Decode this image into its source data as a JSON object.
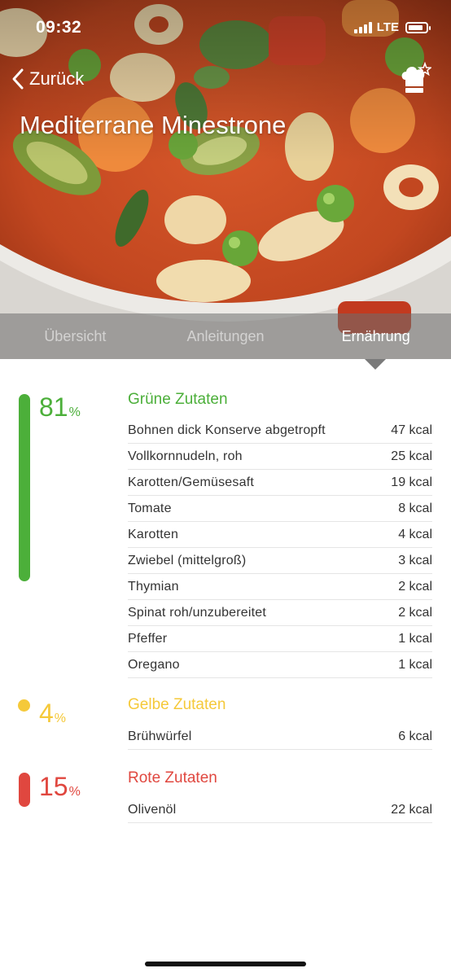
{
  "status_bar": {
    "time": "09:32",
    "network": "LTE"
  },
  "nav": {
    "back_label": "Zurück"
  },
  "recipe": {
    "title": "Mediterrane Minestrone"
  },
  "tabs": [
    {
      "label": "Übersicht",
      "active": false
    },
    {
      "label": "Anleitungen",
      "active": false
    },
    {
      "label": "Ernährung",
      "active": true
    }
  ],
  "groups": [
    {
      "percent": "81",
      "percent_symbol": "%",
      "title": "Grüne Zutaten",
      "color": "#4caf3a",
      "items": [
        {
          "name": "Bohnen dick Konserve abgetropft",
          "kcal": "47 kcal"
        },
        {
          "name": "Vollkornnudeln, roh",
          "kcal": "25 kcal"
        },
        {
          "name": "Karotten/Gemüsesaft",
          "kcal": "19 kcal"
        },
        {
          "name": "Tomate",
          "kcal": "8 kcal"
        },
        {
          "name": "Karotten",
          "kcal": "4 kcal"
        },
        {
          "name": "Zwiebel (mittelgroß)",
          "kcal": "3 kcal"
        },
        {
          "name": "Thymian",
          "kcal": "2 kcal"
        },
        {
          "name": "Spinat roh/unzubereitet",
          "kcal": "2 kcal"
        },
        {
          "name": "Pfeffer",
          "kcal": "1 kcal"
        },
        {
          "name": "Oregano",
          "kcal": "1 kcal"
        }
      ]
    },
    {
      "percent": "4",
      "percent_symbol": "%",
      "title": "Gelbe Zutaten",
      "color": "#f5c93a",
      "items": [
        {
          "name": "Brühwürfel",
          "kcal": "6 kcal"
        }
      ]
    },
    {
      "percent": "15",
      "percent_symbol": "%",
      "title": "Rote Zutaten",
      "color": "#e0473f",
      "items": [
        {
          "name": "Olivenöl",
          "kcal": "22 kcal"
        }
      ]
    }
  ],
  "icons": {
    "back": "chevron-left-icon",
    "chef": "chef-hat-star-icon",
    "battery": "battery-icon",
    "signal": "signal-icon"
  }
}
